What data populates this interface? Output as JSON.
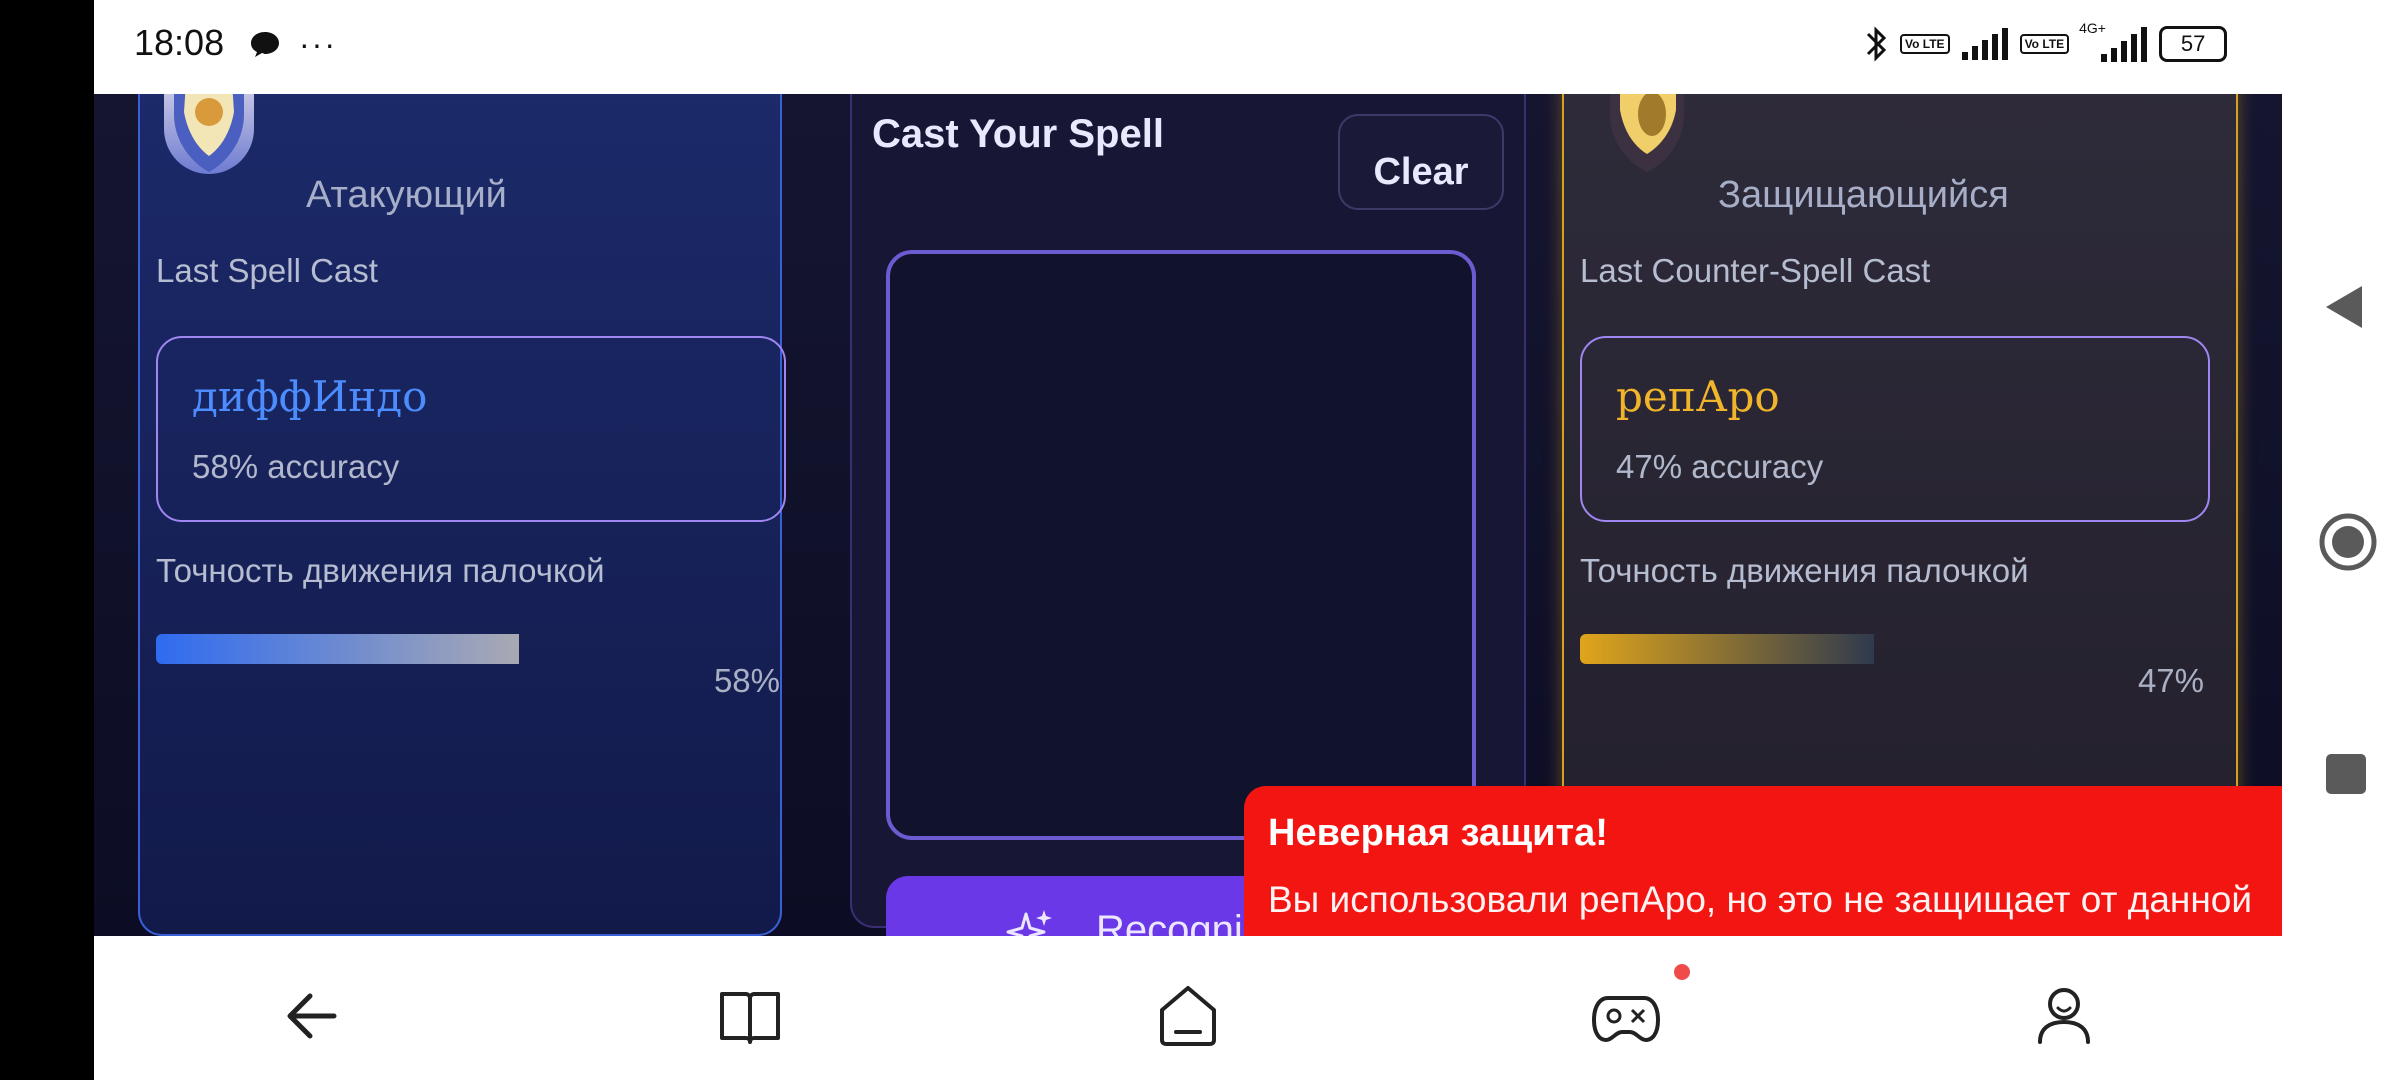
{
  "status_bar": {
    "time": "18:08",
    "more": "···",
    "volte1": "Vo LTE",
    "volte2": "Vo LTE",
    "network": "4G+",
    "battery": "57"
  },
  "attacker": {
    "role": "Атакующий",
    "last_spell_label": "Last Spell Cast",
    "spell_name": "диффИндо",
    "accuracy_text": "58% accuracy",
    "wand_label": "Точность движения палочкой",
    "wand_percent_text": "58%",
    "wand_level": 0.58,
    "accent_color": "#2f6bf0"
  },
  "center": {
    "canvas_title": "Cast Your Spell",
    "clear_label": "Clear",
    "recognize_label": "Recognize"
  },
  "defender": {
    "role": "Защищающийся",
    "last_spell_label": "Last Counter-Spell Cast",
    "spell_name": "репАро",
    "accuracy_text": "47% accuracy",
    "wand_label": "Точность движения палочкой",
    "wand_percent_text": "47%",
    "wand_level": 0.47,
    "accent_color": "#e0a51a"
  },
  "toast": {
    "title": "Неверная защита!",
    "message": "Вы использовали репАро, но это не защищает от данной атаки.",
    "color": "#f31512"
  },
  "bottom_nav": {
    "items": [
      "back-icon",
      "book-icon",
      "home-icon",
      "gamepad-icon",
      "profile-icon"
    ],
    "badge_on": "gamepad-icon"
  },
  "system_nav": [
    "triangle-back-icon",
    "circle-home-icon",
    "square-recents-icon"
  ]
}
